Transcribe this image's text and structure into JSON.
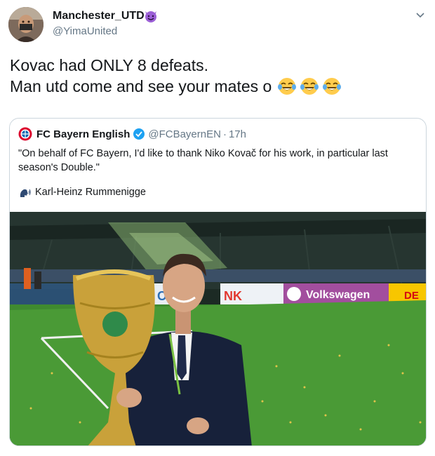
{
  "author": {
    "display_name": "Manchester_UTD",
    "handle": "@YimaUnited",
    "badge_icon": "smiling-devil-emoji",
    "menu_icon": "chevron-down-icon"
  },
  "tweet": {
    "line1": "Kovac had ONLY 8 defeats.",
    "line2": "Man utd come and see your mates o",
    "emojis": [
      "face-with-tears-of-joy",
      "face-with-tears-of-joy",
      "face-with-tears-of-joy"
    ]
  },
  "quoted_tweet": {
    "display_name": "FC Bayern English",
    "handle": "@FCBayernEN",
    "separator": "·",
    "time": "17h",
    "text": "\"On behalf of FC Bayern, I'd like to thank Niko Kovač for his work, in particular last season's Double.\"",
    "attribution": "Karl-Heinz Rummenigge",
    "verified": true,
    "photo": {
      "subject": "man in suit holding DFB-Pokal trophy in stadium",
      "ad_boards": [
        "O",
        "NK",
        "Volkswagen",
        "DE"
      ]
    }
  },
  "colors": {
    "text": "#14171a",
    "secondary": "#657786",
    "verified": "#1da1f2",
    "border": "#ccd6dd",
    "bayern_red": "#dc052d"
  }
}
